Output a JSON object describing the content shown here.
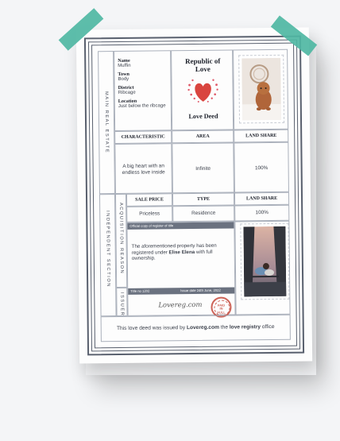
{
  "deed": {
    "fields": [
      {
        "label": "Name",
        "value": "Muffin"
      },
      {
        "label": "Town",
        "value": "Body"
      },
      {
        "label": "District",
        "value": "Ribcage"
      },
      {
        "label": "Location",
        "value": "Just below the ribcage"
      }
    ],
    "republic": "Republic of Love",
    "deed_title": "Love Deed",
    "side_main": "Main real estate",
    "side_acq": "Acquisition reason",
    "side_issuer": "Issuer",
    "side_independent": "Independent section",
    "table1": {
      "headers": [
        "CHARACTERISTIC",
        "AREA",
        "LAND SHARE"
      ],
      "row": [
        "A big heart with an endless love inside",
        "Infinite",
        "100%"
      ]
    },
    "table2": {
      "headers": [
        "SALE PRICE",
        "TYPE",
        "LAND SHARE"
      ],
      "row": [
        "Priceless",
        "Residence",
        "100%"
      ]
    },
    "official_copy": "Official copy of register of title",
    "registered_pre": "The aforementioned property has been registered under ",
    "registered_name": "Elise Elena",
    "registered_post": " with full ownership.",
    "title_no": "Title no 1202",
    "issue_date": "Issue date 24th June, 2022",
    "signature": "Lovereg.com",
    "stamp_text": "PAID IN FULL",
    "footer_pre": "This love deed was issued by ",
    "footer_site": "Lovereg.com",
    "footer_mid": " the ",
    "footer_office": "love registry",
    "footer_post": " office"
  },
  "colors": {
    "tape": "#4fb7a3",
    "border": "#59606e",
    "bar": "#6b7280",
    "heart": "#d9453f",
    "stamp": "#c0392b"
  }
}
